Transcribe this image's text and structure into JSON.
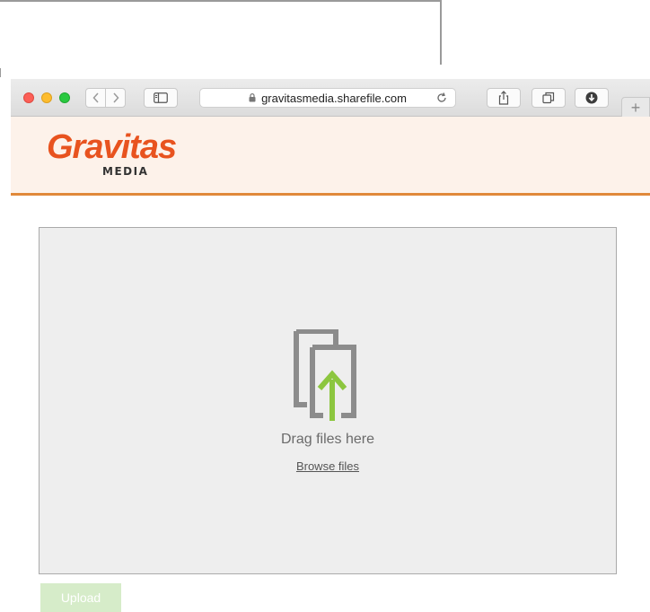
{
  "browser": {
    "url": "gravitasmedia.sharefile.com",
    "new_tab_label": "+"
  },
  "header": {
    "logo_main": "Gravitas",
    "logo_sub": "MEDIA",
    "brand_color": "#e8531f",
    "accent_line_color": "#e0893a"
  },
  "dropzone": {
    "drag_text": "Drag files here",
    "browse_link": "Browse files",
    "icon": "upload-files-icon",
    "arrow_color": "#8cc63f"
  },
  "actions": {
    "upload_label": "Upload",
    "upload_enabled": false
  }
}
